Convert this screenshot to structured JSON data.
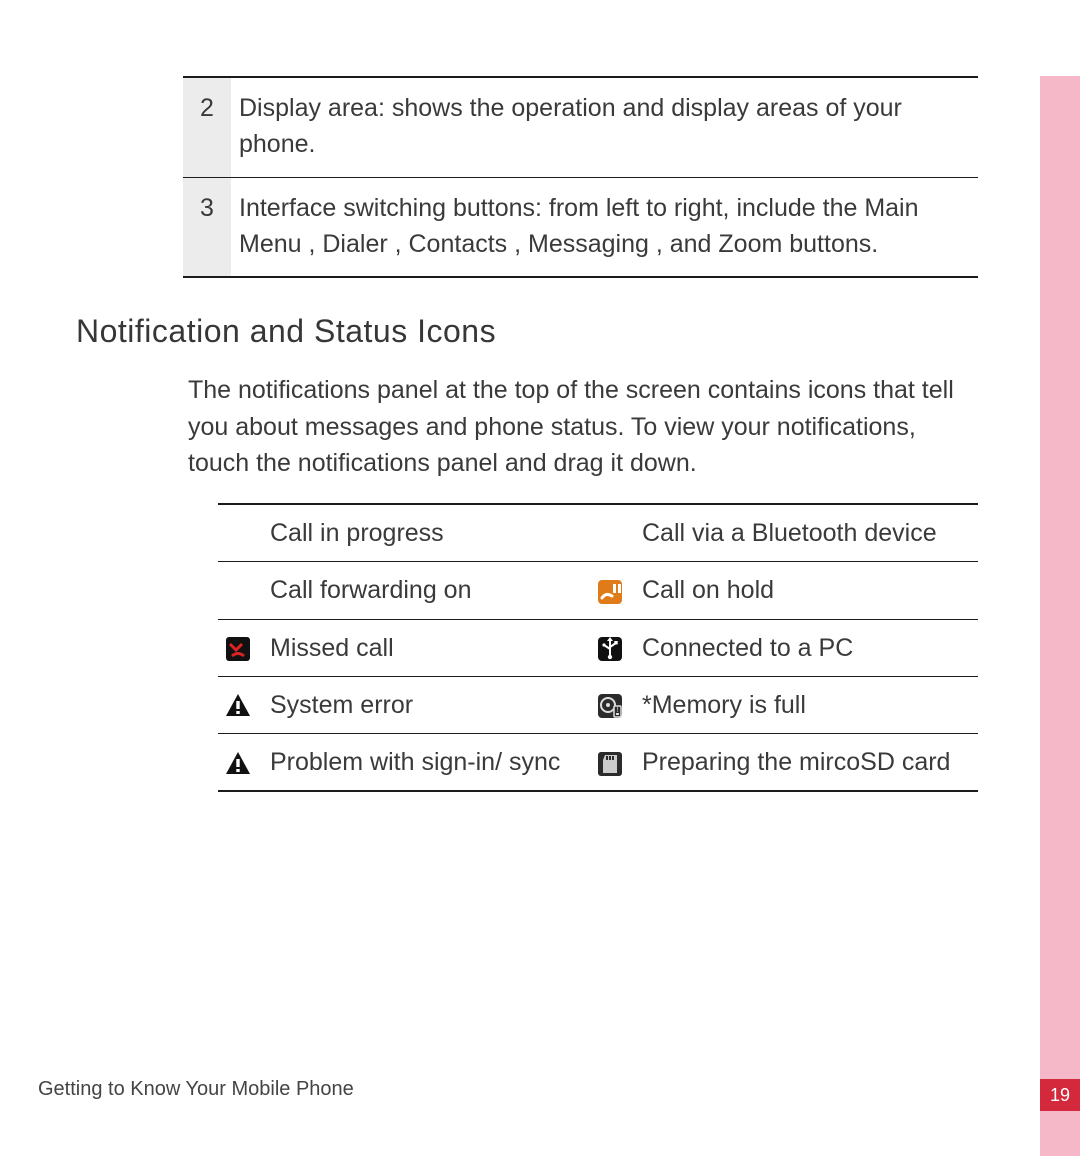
{
  "numbered_rows": [
    {
      "n": "2",
      "text": "Display area: shows the operation and display areas of your phone."
    },
    {
      "n": "3",
      "text": "Interface switching buttons: from left to right, include the Main Menu , Dialer , Contacts , Messaging , and Zoom  buttons."
    }
  ],
  "section_title": "Notification and Status Icons",
  "section_body": "The notifications panel at the top of the screen contains icons that tell you about messages and phone status. To view your notifications, touch the notifications panel and drag it down.",
  "icon_rows": [
    {
      "l_icon": "",
      "l_text": "Call in progress",
      "r_icon": "",
      "r_text": "Call via a Bluetooth device"
    },
    {
      "l_icon": "",
      "l_text": "Call forwarding on",
      "r_icon": "call-hold",
      "r_text": "Call on hold"
    },
    {
      "l_icon": "missed-call",
      "l_text": "Missed call",
      "r_icon": "usb",
      "r_text": "Connected to a PC"
    },
    {
      "l_icon": "warning",
      "l_text": "System error",
      "r_icon": "disk",
      "r_text": "*Memory is full"
    },
    {
      "l_icon": "warning",
      "l_text": "Problem with sign-in/ sync",
      "r_icon": "sd",
      "r_text": "Preparing the mircoSD  card"
    }
  ],
  "footer_chapter": "Getting to Know Your Mobile Phone",
  "page_number": "19"
}
